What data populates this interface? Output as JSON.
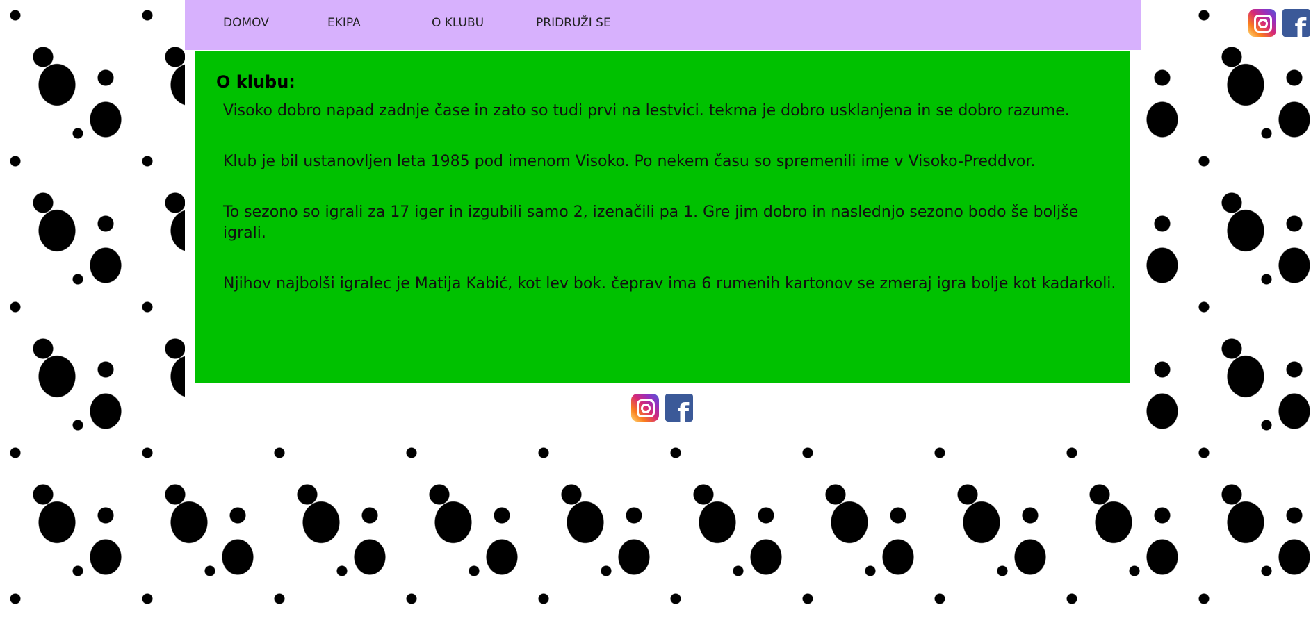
{
  "nav": {
    "items": [
      {
        "label": "DOMOV"
      },
      {
        "label": "EKIPA"
      },
      {
        "label": "O KLUBU"
      },
      {
        "label": "PRIDRUŽI SE"
      }
    ]
  },
  "social": {
    "icons": [
      "instagram-icon",
      "facebook-icon"
    ]
  },
  "content": {
    "title": "O klubu:",
    "paragraphs": [
      "Visoko dobro napad zadnje čase in zato so tudi prvi na lestvici. tekma je dobro usklanjena in se dobro razume.",
      "Klub je bil ustanovljen leta 1985 pod imenom Visoko. Po nekem času so spremenili ime v Visoko-Preddvor.",
      "To sezono so igrali za 17 iger in izgubili samo 2, izenačili pa 1. Gre jim dobro in naslednjo sezono bodo še boljše igrali.",
      "Njihov najbolši igralec je Matija Kabić, kot lev bok. čeprav ima 6 rumenih kartonov se zmeraj igra bolje kot kadarkoli."
    ]
  },
  "colors": {
    "nav_background": "#d7b1fd",
    "content_background": "#00c100",
    "page_background": "#ffffff",
    "pattern": "#000000"
  }
}
